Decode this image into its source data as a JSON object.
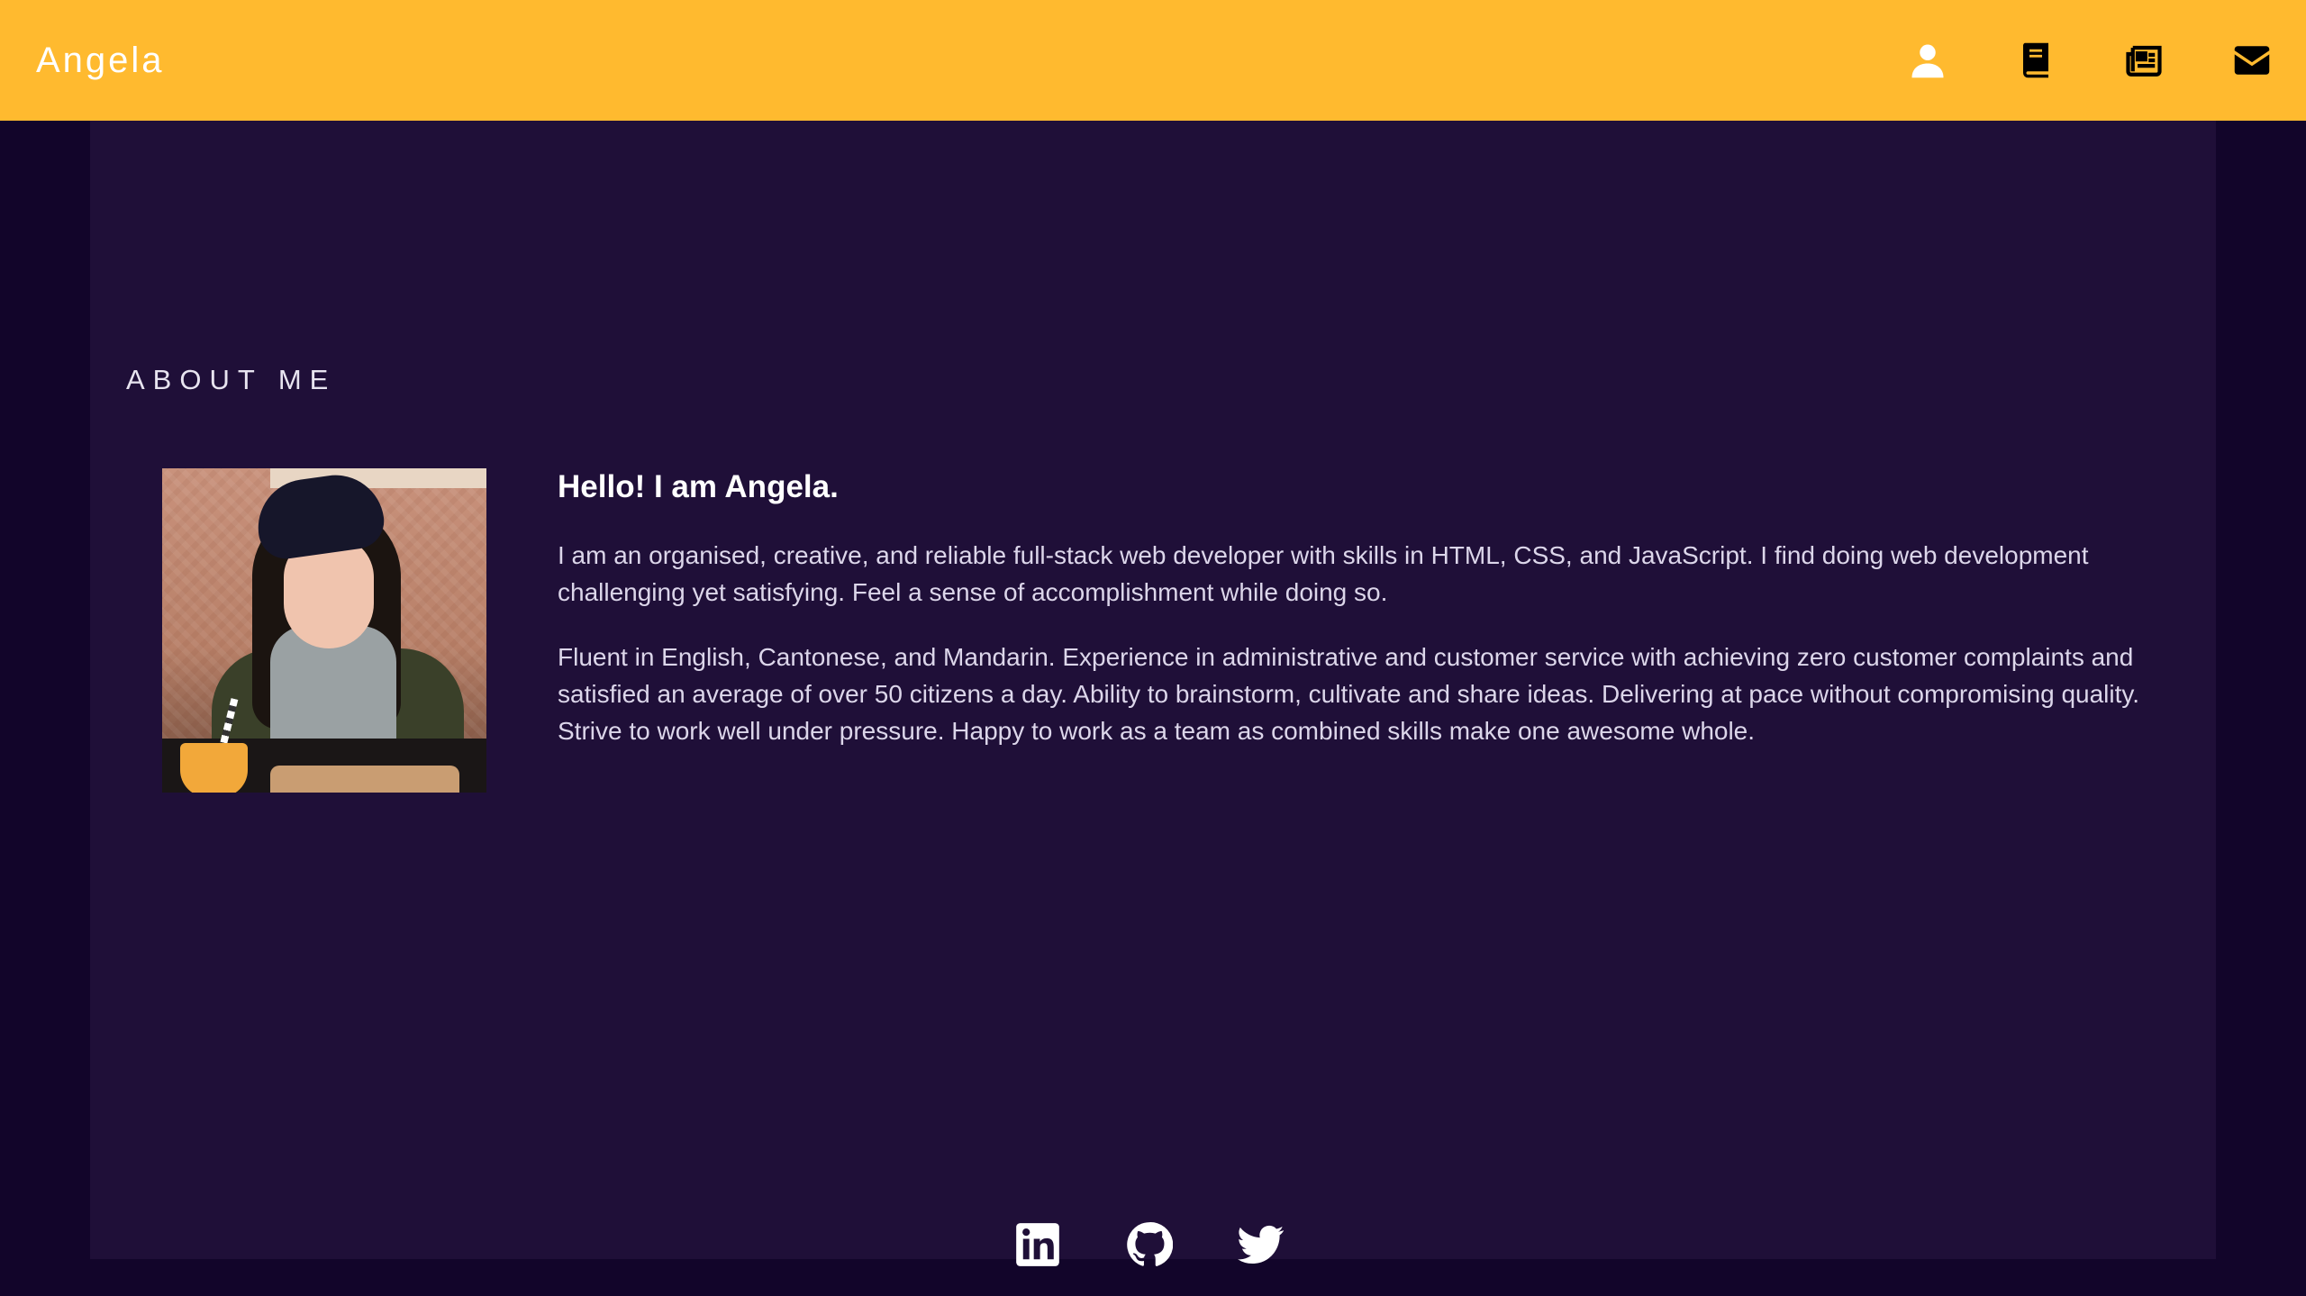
{
  "navbar": {
    "brand": "Angela",
    "icons": [
      "user-icon",
      "book-icon",
      "newspaper-icon",
      "envelope-icon"
    ],
    "background": "#ffba2f"
  },
  "about": {
    "section_title": "ABOUT ME",
    "headline": "Hello! I am Angela.",
    "paragraphs": [
      "I am an organised, creative, and reliable full-stack web developer with skills in HTML, CSS, and JavaScript. I find doing web development challenging yet satisfying. Feel a sense of accomplishment while doing so.",
      "Fluent in English, Cantonese, and Mandarin. Experience in administrative and customer service with achieving zero customer complaints and satisfied an average of over 50 citizens a day. Ability to brainstorm, cultivate and share ideas. Delivering at pace without compromising quality. Strive to work well under pressure. Happy to work as a team as combined skills make one awesome whole."
    ]
  },
  "footer": {
    "social_icons": [
      "linkedin-icon",
      "github-icon",
      "twitter-icon"
    ]
  },
  "colors": {
    "page_bg": "#12052a",
    "content_bg": "#1f0f38",
    "accent": "#ffba2f",
    "text": "#dcd6ea"
  }
}
